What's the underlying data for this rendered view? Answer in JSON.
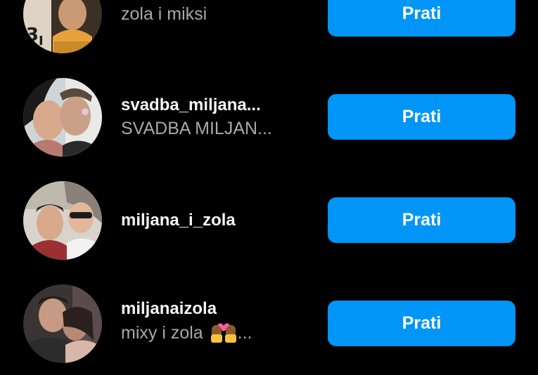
{
  "accounts": [
    {
      "username": "",
      "fullname": "zola i miksi",
      "follow_label": "Prati"
    },
    {
      "username": "svadba_miljana...",
      "fullname": "SVADBA MILJAN...",
      "follow_label": "Prati"
    },
    {
      "username": "miljana_i_zola",
      "fullname": "",
      "follow_label": "Prati"
    },
    {
      "username": "miljanaizola",
      "fullname": "mixy i zola",
      "fullname_emoji": "couple-with-heart-icon",
      "fullname_suffix": "...",
      "follow_label": "Prati"
    }
  ],
  "colors": {
    "background": "#000000",
    "follow_button": "#0095f6",
    "username": "#f5f5f5",
    "fullname": "#a8a8a8"
  }
}
